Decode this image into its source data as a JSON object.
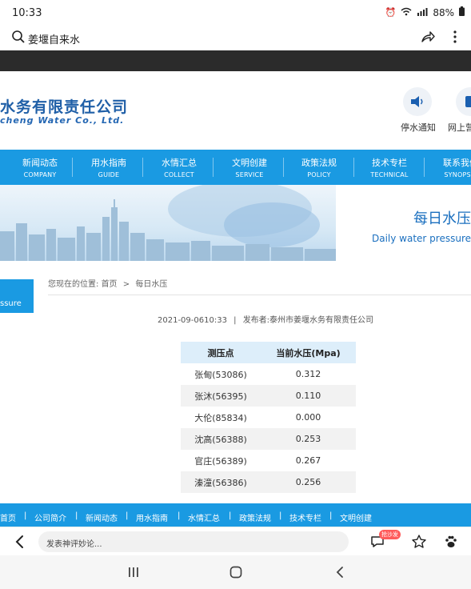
{
  "status": {
    "time": "10:33",
    "battery": "88%"
  },
  "address": {
    "query": "姜堰自来水"
  },
  "header": {
    "logo_cn": "水务有限责任公司",
    "logo_en": "cheng Water Co., Ltd.",
    "icons": [
      {
        "label": "停水通知",
        "icon": "speaker-icon"
      },
      {
        "label": "网上营",
        "icon": "service-icon"
      }
    ]
  },
  "nav": {
    "items": [
      {
        "cn": "新闻动态",
        "en": "COMPANY"
      },
      {
        "cn": "用水指南",
        "en": "GUIDE"
      },
      {
        "cn": "水情汇总",
        "en": "COLLECT"
      },
      {
        "cn": "文明创建",
        "en": "SERVICE"
      },
      {
        "cn": "政策法规",
        "en": "POLICY"
      },
      {
        "cn": "技术专栏",
        "en": "TECHNICAL"
      },
      {
        "cn": "联系我们",
        "en": "SYNOPSIS"
      }
    ]
  },
  "banner": {
    "title": "每日水压",
    "subtitle": "Daily water pressure"
  },
  "side_tab": {
    "label": "ssure"
  },
  "breadcrumb": {
    "prefix": "您现在的位置:",
    "home": "首页",
    "sep": ">",
    "current": "每日水压"
  },
  "meta": {
    "datetime": "2021-09-0610:33",
    "divider": "|",
    "publisher": "发布者:泰州市姜堰水务有限责任公司"
  },
  "table": {
    "headers": [
      "测压点",
      "当前水压(Mpa)"
    ],
    "rows": [
      {
        "point": "张甸(53086)",
        "value": "0.312"
      },
      {
        "point": "张沐(56395)",
        "value": "0.110"
      },
      {
        "point": "大伦(85834)",
        "value": "0.000"
      },
      {
        "point": "沈高(56388)",
        "value": "0.253"
      },
      {
        "point": "官庄(56389)",
        "value": "0.267"
      },
      {
        "point": "溱潼(56386)",
        "value": "0.256"
      }
    ]
  },
  "footer_nav": {
    "items": [
      "首页",
      "|",
      "公司简介",
      "|",
      "新闻动态",
      "|",
      "用水指南",
      "|",
      "水情汇总",
      "|",
      "政策法规",
      "|",
      "技术专栏",
      "|",
      "文明创建"
    ]
  },
  "browser": {
    "comment_placeholder": "发表神评妙论...",
    "badge": "抢沙发"
  },
  "colors": {
    "nav_blue": "#1a9ae2",
    "logo_blue": "#1f5fa7",
    "table_header": "#ddeefa"
  }
}
